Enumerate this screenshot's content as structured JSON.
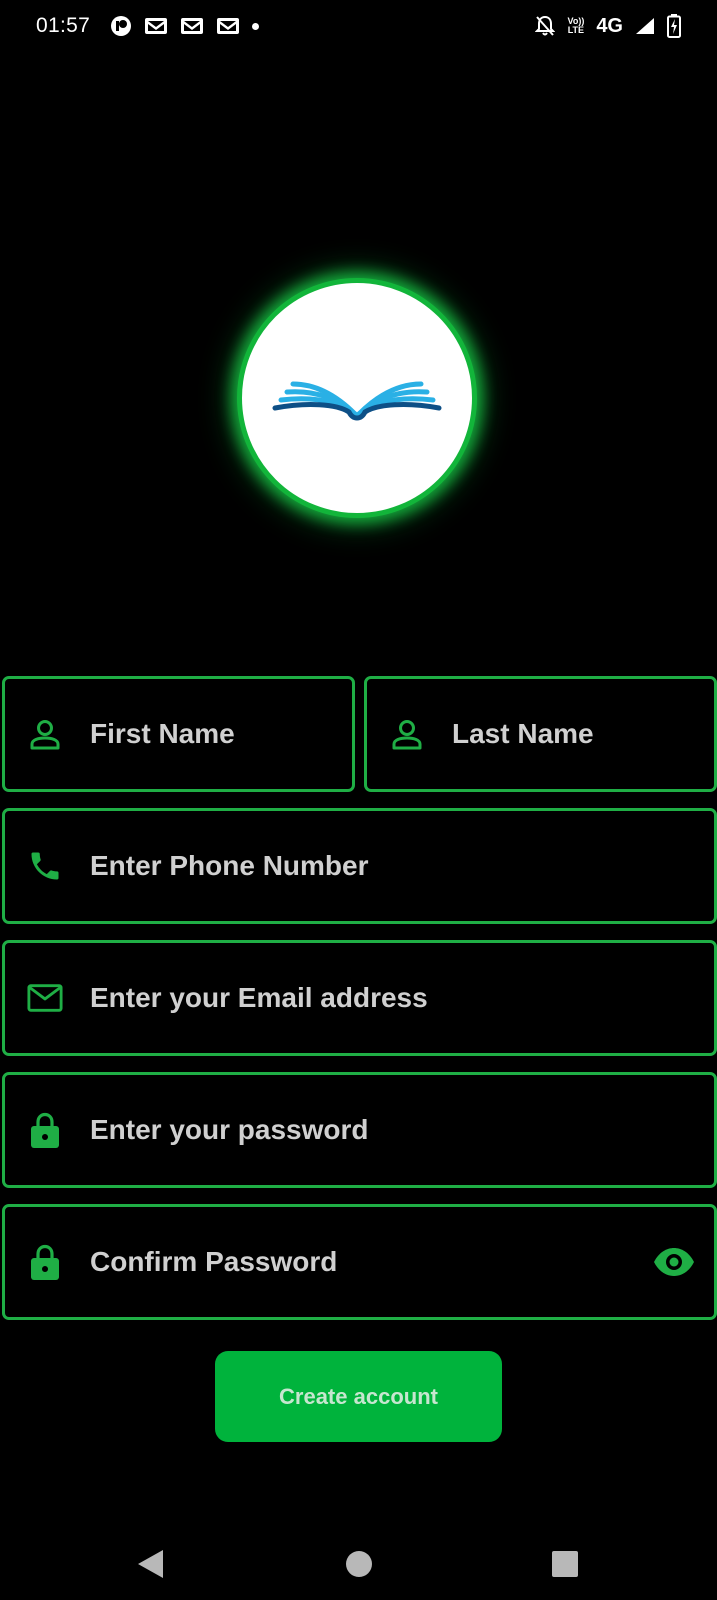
{
  "status_bar": {
    "time": "01:57",
    "network": "4G",
    "volte_top": "Vo))",
    "volte_bottom": "LTE",
    "notification_icons": [
      "circle-app-icon",
      "gmail-icon",
      "gmail-icon",
      "gmail-icon",
      "dot-icon"
    ],
    "right_icons": [
      "bell-off-icon",
      "volte-icon",
      "network-label",
      "signal-icon",
      "battery-charging-icon"
    ]
  },
  "logo": {
    "icon": "open-book-icon",
    "colors": {
      "light_blue": "#2ab0e5",
      "dark_blue": "#0d4f86",
      "glow": "#12b53a"
    }
  },
  "form": {
    "first_name": {
      "placeholder": "First Name",
      "value": "",
      "icon": "person-icon"
    },
    "last_name": {
      "placeholder": "Last Name",
      "value": "",
      "icon": "person-icon"
    },
    "phone": {
      "placeholder": "Enter Phone Number",
      "value": "",
      "icon": "phone-icon"
    },
    "email": {
      "placeholder": "Enter your Email address",
      "value": "",
      "icon": "mail-icon"
    },
    "password": {
      "placeholder": "Enter your password",
      "value": "",
      "icon": "lock-icon"
    },
    "confirm_password": {
      "placeholder": "Confirm Password",
      "value": "",
      "icon": "lock-icon",
      "trailing_icon": "eye-icon"
    },
    "submit_label": "Create account"
  },
  "colors": {
    "background": "#000000",
    "accent": "#1fae45",
    "button": "#00b33c",
    "button_text": "#c6e6cf",
    "placeholder_text": "#d0d0d0"
  },
  "nav_bar": {
    "items": [
      "back-icon",
      "home-icon",
      "recents-icon"
    ]
  }
}
